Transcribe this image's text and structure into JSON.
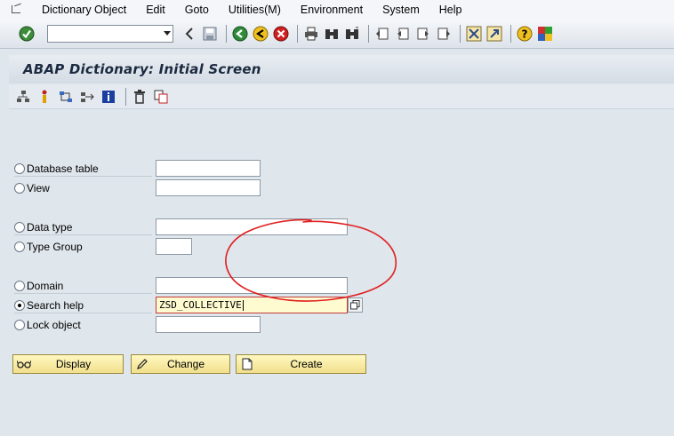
{
  "menubar": {
    "items": [
      "Dictionary Object",
      "Edit",
      "Goto",
      "Utilities(M)",
      "Environment",
      "System",
      "Help"
    ]
  },
  "toolbar": {
    "command_field_value": "",
    "icons": [
      "enter-icon",
      "back-icon",
      "save-icon",
      "back-green-icon",
      "exit-icon",
      "cancel-icon",
      "print-icon",
      "find-icon",
      "find-next-icon",
      "first-page-icon",
      "previous-page-icon",
      "next-page-icon",
      "last-page-icon",
      "create-session-icon",
      "shortcut-icon",
      "help-icon",
      "customize-layout-icon"
    ]
  },
  "title": "ABAP Dictionary: Initial Screen",
  "app_toolbar": {
    "icons": [
      "object-hierarchy-icon",
      "where-used-icon",
      "display-object-list-icon",
      "other-object-icon",
      "information-icon",
      "delete-icon",
      "copy-icon"
    ]
  },
  "form": {
    "database_table": {
      "label": "Database table",
      "value": ""
    },
    "view": {
      "label": "View",
      "value": ""
    },
    "data_type": {
      "label": "Data type",
      "value": ""
    },
    "type_group": {
      "label": "Type Group",
      "value": ""
    },
    "domain": {
      "label": "Domain",
      "value": ""
    },
    "search_help": {
      "label": "Search help",
      "value": "ZSD_COLLECTIVE",
      "selected": true
    },
    "lock_object": {
      "label": "Lock object",
      "value": ""
    }
  },
  "buttons": {
    "display": "Display",
    "change": "Change",
    "create": "Create"
  },
  "colors": {
    "annotation": "#e02020",
    "button_bg": "#f7ec9e",
    "required_field_bg": "#fffbd0"
  }
}
